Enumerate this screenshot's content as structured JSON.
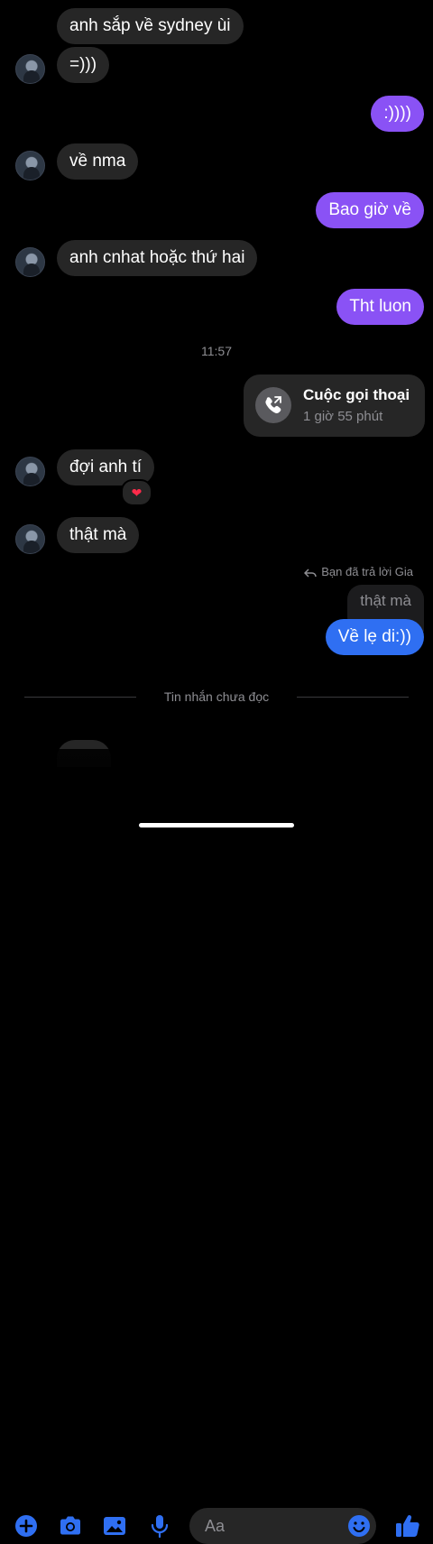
{
  "messages": [
    {
      "side": "in",
      "text": "anh sắp về sydney ùi"
    },
    {
      "side": "in",
      "text": "=)))"
    },
    {
      "side": "out",
      "text": ":))))"
    },
    {
      "side": "in",
      "text": "về nma"
    },
    {
      "side": "out",
      "text": "Bao giờ về"
    },
    {
      "side": "in",
      "text": "anh cnhat hoặc thứ hai"
    },
    {
      "side": "out",
      "text": "Tht luon"
    },
    {
      "side": "in",
      "text": "đợi anh tí",
      "reaction": "❤"
    },
    {
      "side": "in",
      "text": "thật mà"
    },
    {
      "side": "out",
      "text": "Về lẹ di:))"
    }
  ],
  "timestamp": "11:57",
  "call": {
    "title": "Cuộc gọi thoại",
    "duration": "1 giờ 55 phút"
  },
  "reply": {
    "note": "Bạn đã trả lời Gia",
    "quoted_text": "thật mà"
  },
  "unread_label": "Tin nhắn chưa đọc",
  "composer": {
    "placeholder": "Aa",
    "icons": [
      "plus-icon",
      "camera-icon",
      "gallery-icon",
      "microphone-icon",
      "emoji-icon",
      "thumbs-up-icon"
    ]
  },
  "colors": {
    "accent": "#2f6ff2",
    "outgoing": "#8a52f5",
    "incoming": "#262626",
    "background": "#000000"
  }
}
